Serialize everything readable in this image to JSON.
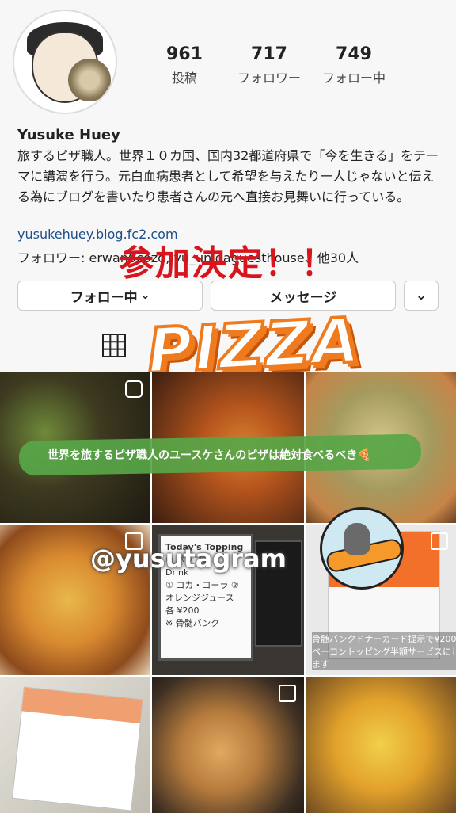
{
  "profile": {
    "name": "Yusuke Huey",
    "bio": "旅するピザ職人。世界１０カ国、国内32都道府県で「今を生きる」をテーマに講演を行う。元白血病患者として希望を与えたり一人じゃないと伝える為にブログを書いたり患者さんの元へ直接お見舞いに行っている。",
    "link": "yusukehuey.blog.fc2.com",
    "followers_line": "フォロワー: erwan0cozd, yu_unigaguesthouse、他30人"
  },
  "stats": [
    {
      "value": "961",
      "label": "投稿"
    },
    {
      "value": "717",
      "label": "フォロワー"
    },
    {
      "value": "749",
      "label": "フォロー中"
    }
  ],
  "buttons": {
    "follow": "フォロー中",
    "message": "メッセージ",
    "more": "⌄"
  },
  "overlays": {
    "decided": "参加決定！！",
    "pizza_sticker": "PIZZA",
    "banner": "世界を旅するピザ職人のユースケさんのピザは絶対食べるべき🍕",
    "handle": "@yusutagram"
  },
  "posts": {
    "board_title": "Today's Topping",
    "board_lines": [
      "② ポップス",
      "Drink",
      "① コカ・コーラ ② オレンジジュース",
      "各 ¥200",
      "※ 骨髄バンク"
    ],
    "card_caption": "骨髄バンクドナーカード提示で¥200ベーコントッピング半額サービスにします"
  },
  "colors": {
    "accent_red": "#d8141c",
    "link_blue": "#1d4f8c",
    "sticker_orange": "#f07a1e",
    "banner_green": "#58a648"
  }
}
